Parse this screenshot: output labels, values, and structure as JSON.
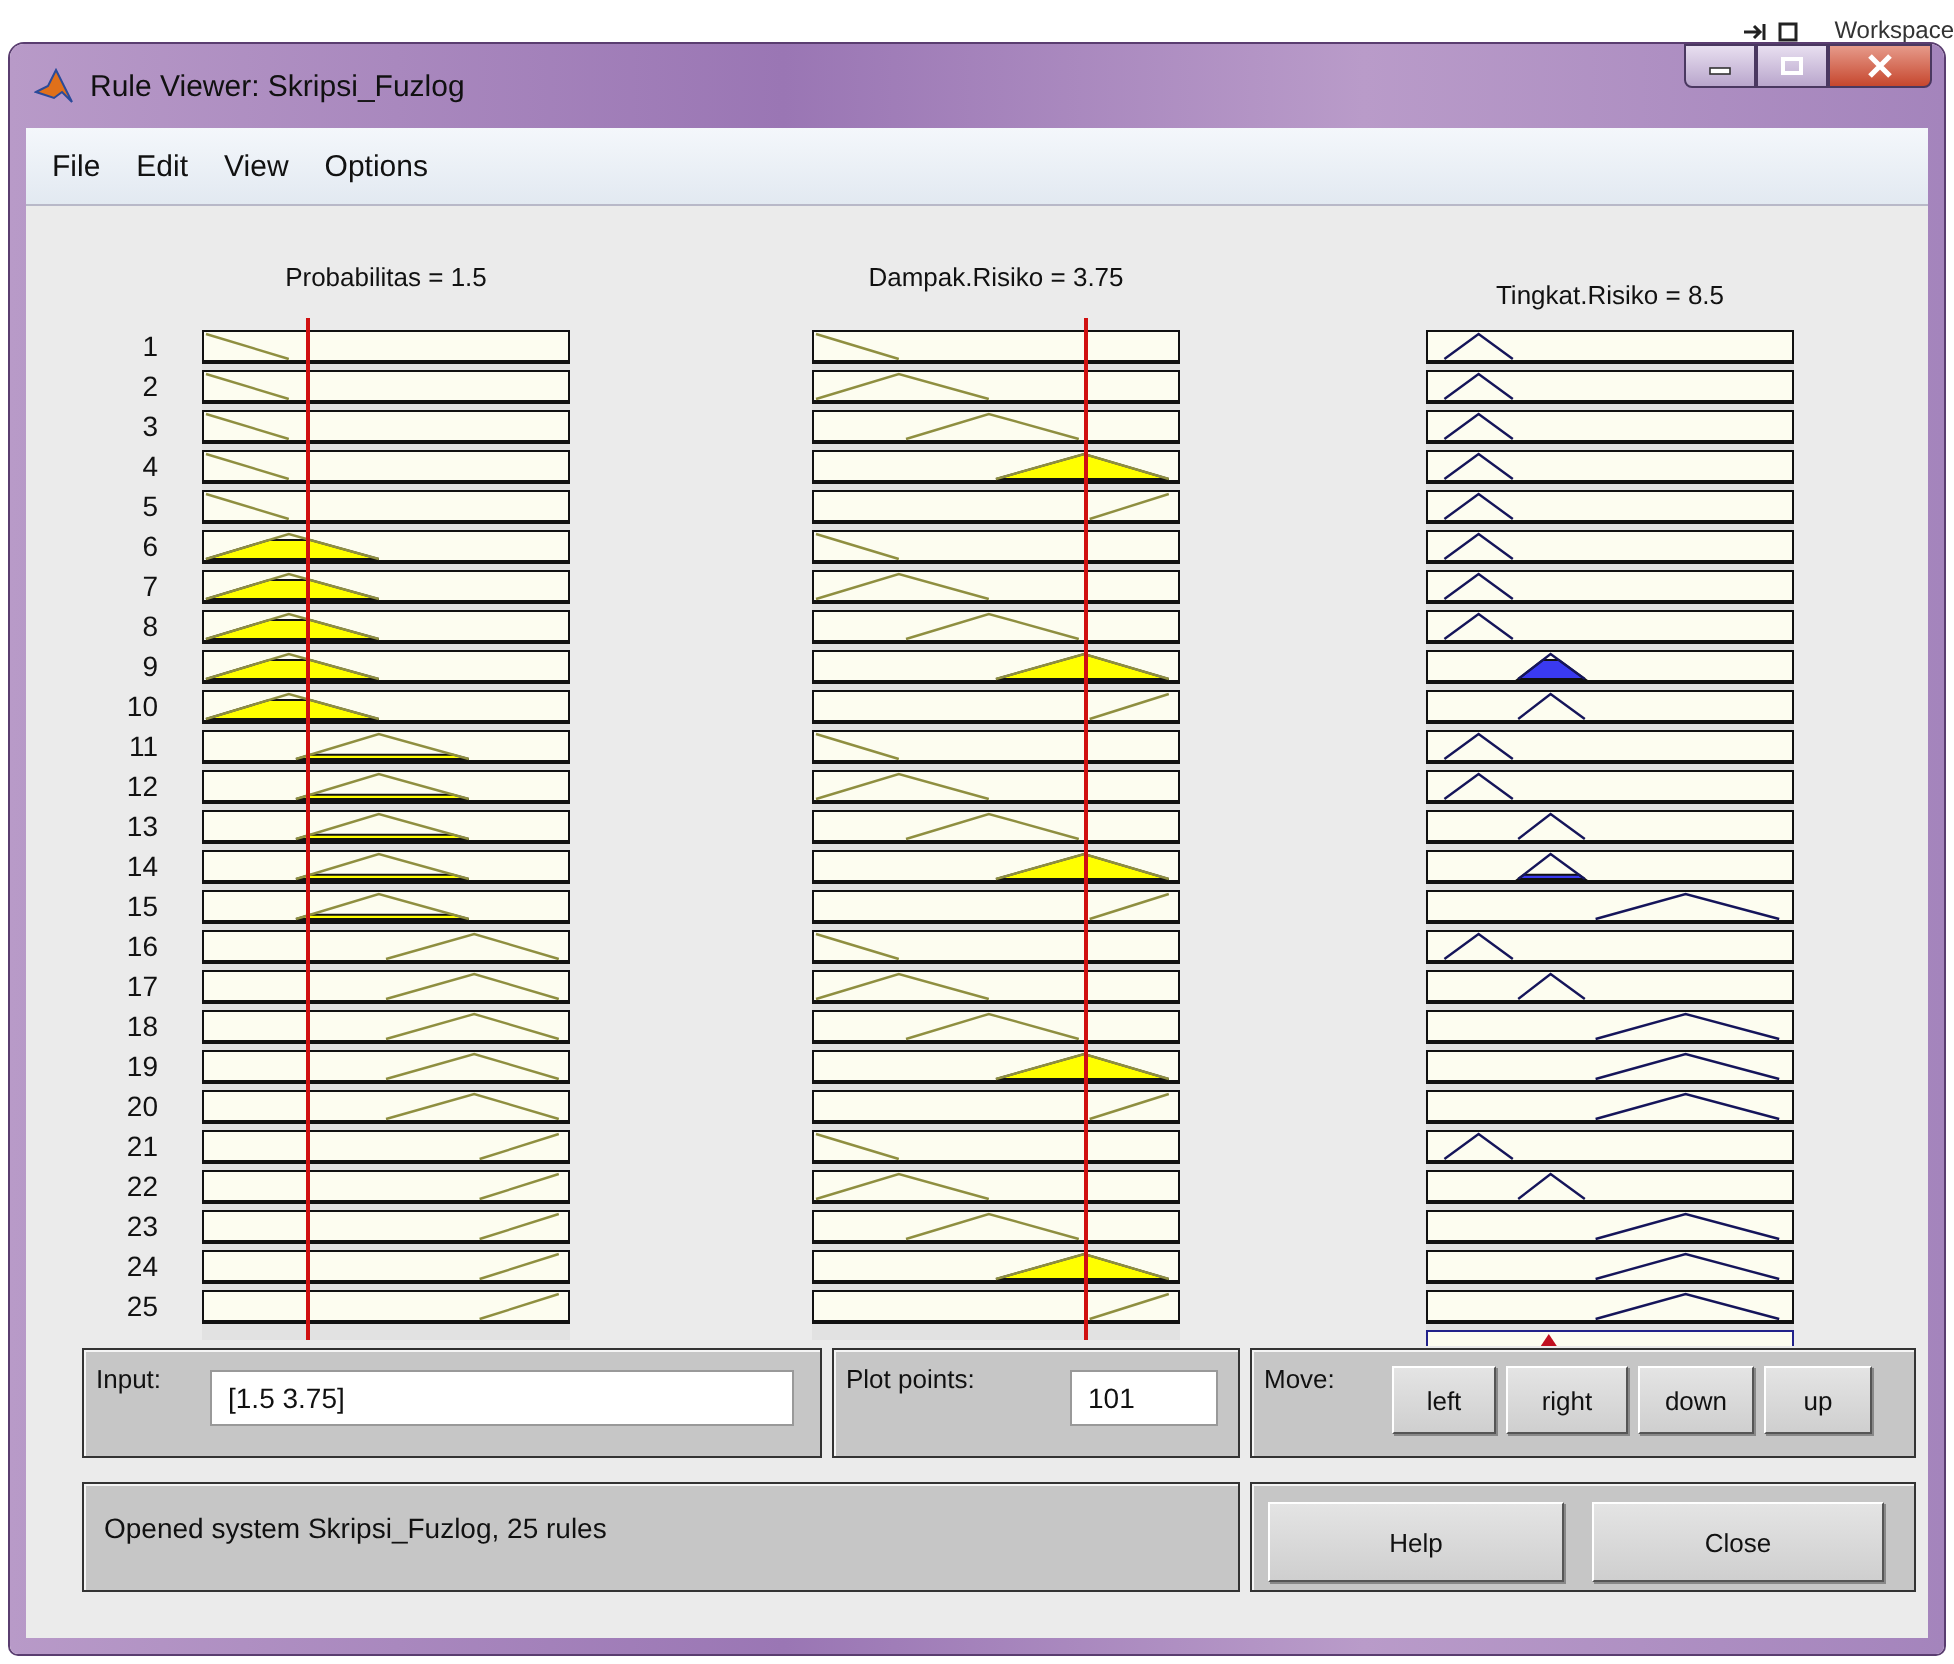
{
  "backdrop": {
    "title": "Workspace"
  },
  "window": {
    "title": "Rule Viewer: Skripsi_Fuzlog"
  },
  "menu": [
    "File",
    "Edit",
    "View",
    "Options"
  ],
  "rule_numbers": [
    "1",
    "2",
    "3",
    "4",
    "5",
    "6",
    "7",
    "8",
    "9",
    "10",
    "11",
    "12",
    "13",
    "14",
    "15",
    "16",
    "17",
    "18",
    "19",
    "20",
    "21",
    "22",
    "23",
    "24",
    "25"
  ],
  "columns": [
    {
      "header": "Probabilitas = 1.5",
      "kind": "input",
      "plots": [
        {
          "kind": "z"
        },
        {
          "kind": "z"
        },
        {
          "kind": "z"
        },
        {
          "kind": "z"
        },
        {
          "kind": "z"
        },
        {
          "kind": "t1"
        },
        {
          "kind": "t1"
        },
        {
          "kind": "t1"
        },
        {
          "kind": "t1"
        },
        {
          "kind": "t1"
        },
        {
          "kind": "t2"
        },
        {
          "kind": "t2"
        },
        {
          "kind": "t2"
        },
        {
          "kind": "t2"
        },
        {
          "kind": "t2"
        },
        {
          "kind": "t3"
        },
        {
          "kind": "t3"
        },
        {
          "kind": "t3"
        },
        {
          "kind": "t3"
        },
        {
          "kind": "t3"
        },
        {
          "kind": "s"
        },
        {
          "kind": "s"
        },
        {
          "kind": "s"
        },
        {
          "kind": "s"
        },
        {
          "kind": "s"
        }
      ]
    },
    {
      "header": "Dampak.Risiko = 3.75",
      "kind": "input",
      "plots": [
        {
          "kind": "z"
        },
        {
          "kind": "t1"
        },
        {
          "kind": "t2"
        },
        {
          "kind": "t3"
        },
        {
          "kind": "s"
        },
        {
          "kind": "z"
        },
        {
          "kind": "t1"
        },
        {
          "kind": "t2"
        },
        {
          "kind": "t3"
        },
        {
          "kind": "s"
        },
        {
          "kind": "z"
        },
        {
          "kind": "t1"
        },
        {
          "kind": "t2"
        },
        {
          "kind": "t3"
        },
        {
          "kind": "s"
        },
        {
          "kind": "z"
        },
        {
          "kind": "t1"
        },
        {
          "kind": "t2"
        },
        {
          "kind": "t3"
        },
        {
          "kind": "s"
        },
        {
          "kind": "z"
        },
        {
          "kind": "t1"
        },
        {
          "kind": "t2"
        },
        {
          "kind": "t3"
        },
        {
          "kind": "s"
        }
      ]
    },
    {
      "header": "Tingkat.Risiko = 8.5",
      "kind": "output",
      "plots": [
        {
          "kind": "a"
        },
        {
          "kind": "a"
        },
        {
          "kind": "a"
        },
        {
          "kind": "a"
        },
        {
          "kind": "a"
        },
        {
          "kind": "a"
        },
        {
          "kind": "a"
        },
        {
          "kind": "a"
        },
        {
          "kind": "b"
        },
        {
          "kind": "b"
        },
        {
          "kind": "a"
        },
        {
          "kind": "a"
        },
        {
          "kind": "b"
        },
        {
          "kind": "b"
        },
        {
          "kind": "c"
        },
        {
          "kind": "a"
        },
        {
          "kind": "b"
        },
        {
          "kind": "c"
        },
        {
          "kind": "c"
        },
        {
          "kind": "c"
        },
        {
          "kind": "a"
        },
        {
          "kind": "b"
        },
        {
          "kind": "c"
        },
        {
          "kind": "c"
        },
        {
          "kind": "c"
        }
      ]
    }
  ],
  "input": {
    "label": "Input:",
    "value": "[1.5 3.75]"
  },
  "plot_points": {
    "label": "Plot points:",
    "value": "101"
  },
  "move": {
    "label": "Move:",
    "buttons": [
      "left",
      "right",
      "down",
      "up"
    ]
  },
  "status": "Opened system Skripsi_Fuzlog, 25 rules",
  "buttons": [
    "Help",
    "Close"
  ]
}
